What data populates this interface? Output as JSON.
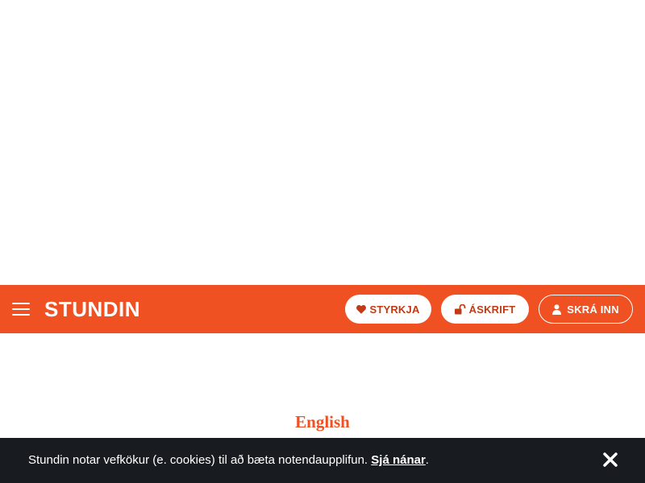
{
  "header": {
    "logo_text": "STUNDIN",
    "buttons": {
      "support_label": "STYRKJA",
      "subscribe_label": "ÁSKRIFT",
      "login_label": "SKRÁ INN"
    },
    "icons": {
      "menu": "hamburger-menu-icon",
      "support": "heart-icon",
      "subscribe": "unlock-icon",
      "login": "user-icon"
    }
  },
  "main": {
    "language_link": "English"
  },
  "cookie_notice": {
    "text": "Stundin notar vefkökur (e. cookies) til að bæta notendaupplifun.",
    "link_text": "Sjá nánar",
    "trailing": ".",
    "close_icon": "close-icon"
  },
  "colors": {
    "brand": "#f05123",
    "cookie_bg": "#181c21",
    "button_text": "#c03a14"
  }
}
